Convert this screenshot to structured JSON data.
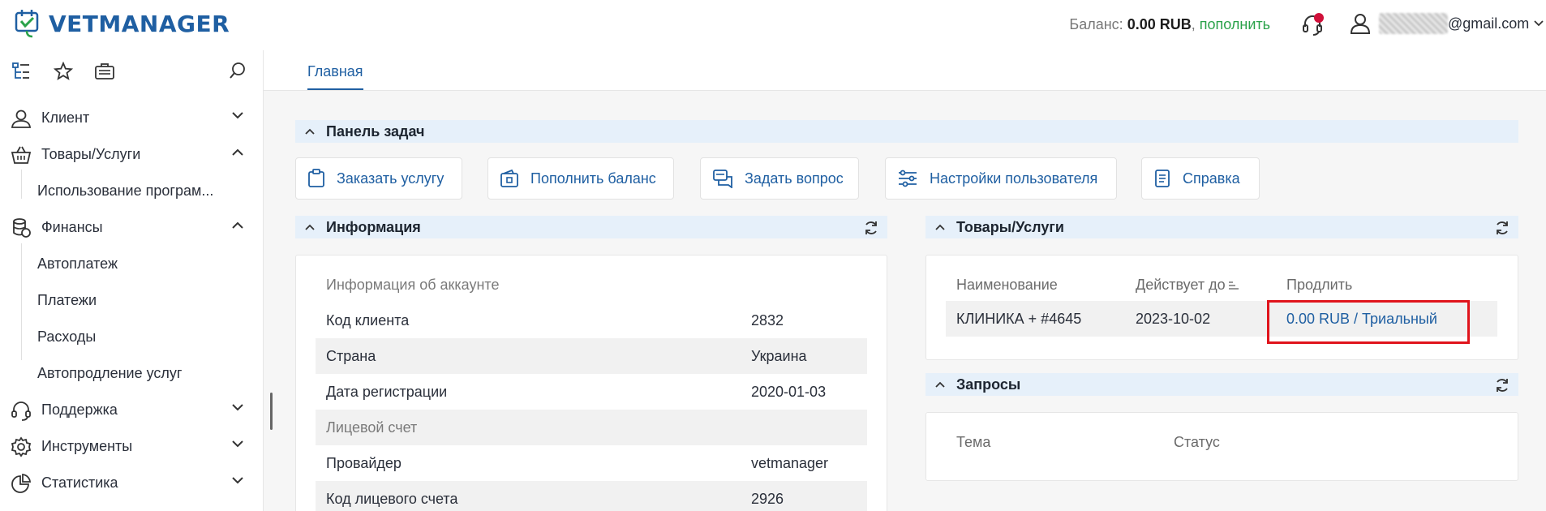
{
  "header": {
    "logo_text": "VETMANAGER",
    "balance_label": "Баланс:",
    "balance_amount": "0.00 RUB",
    "balance_sep": ",",
    "topup_link": "пополнить",
    "user_email": "@gmail.com"
  },
  "colors": {
    "brand": "#1f5fa2",
    "topup": "#2aa24a",
    "section_bg": "#e6f0fa",
    "highlight": "#e0141c",
    "notification_dot": "#d0103a"
  },
  "sidebar": {
    "tools": [
      "tree-icon",
      "star-icon",
      "briefcase-icon",
      "search-icon"
    ],
    "items": [
      {
        "label": "Клиент",
        "icon": "client-icon",
        "expanded": false
      },
      {
        "label": "Товары/Услуги",
        "icon": "basket-icon",
        "expanded": true,
        "children": [
          "Использование програм..."
        ]
      },
      {
        "label": "Финансы",
        "icon": "coins-icon",
        "expanded": true,
        "children": [
          "Автоплатеж",
          "Платежи",
          "Расходы",
          "Автопродление услуг"
        ]
      },
      {
        "label": "Поддержка",
        "icon": "headset-icon",
        "expanded": false
      },
      {
        "label": "Инструменты",
        "icon": "gear-icon",
        "expanded": false
      },
      {
        "label": "Статистика",
        "icon": "pie-chart-icon",
        "expanded": false
      }
    ]
  },
  "tabs": [
    {
      "label": "Главная",
      "active": true
    }
  ],
  "task_panel": {
    "title": "Панель задач",
    "buttons": [
      {
        "label": "Заказать услугу",
        "icon": "clipboard-icon"
      },
      {
        "label": "Пополнить баланс",
        "icon": "wallet-icon"
      },
      {
        "label": "Задать вопрос",
        "icon": "chat-icon"
      },
      {
        "label": "Настройки пользователя",
        "icon": "sliders-icon"
      },
      {
        "label": "Справка",
        "icon": "document-icon"
      }
    ]
  },
  "info": {
    "title": "Информация",
    "rows": [
      {
        "key": "Информация об аккаунте",
        "value": "",
        "muted": true
      },
      {
        "key": "Код клиента",
        "value": "2832"
      },
      {
        "key": "Страна",
        "value": "Украина"
      },
      {
        "key": "Дата регистрации",
        "value": "2020-01-03"
      },
      {
        "key": "Лицевой счет",
        "value": "",
        "muted": true
      },
      {
        "key": "Провайдер",
        "value": "vetmanager"
      },
      {
        "key": "Код лицевого счета",
        "value": "2926"
      }
    ]
  },
  "goods": {
    "title": "Товары/Услуги",
    "columns": [
      "Наименование",
      "Действует до",
      "Продлить"
    ],
    "rows": [
      {
        "name": "КЛИНИКА + #4645",
        "valid_until": "2023-10-02",
        "renew": "0.00 RUB / Триальный"
      }
    ]
  },
  "requests": {
    "title": "Запросы",
    "columns": [
      "Тема",
      "Статус"
    ]
  }
}
